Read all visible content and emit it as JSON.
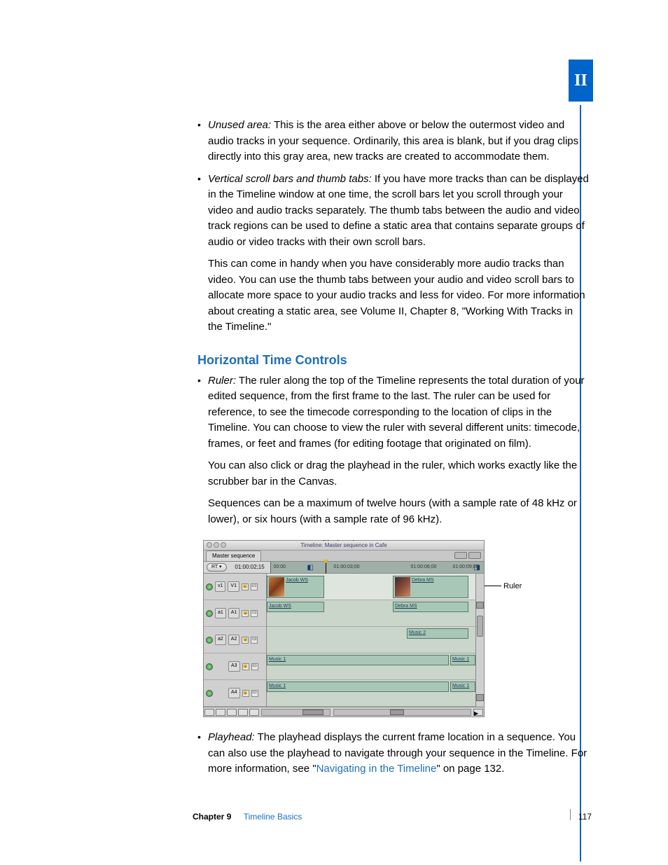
{
  "page": {
    "part_label": "II",
    "chapter_label": "Chapter 9",
    "chapter_title": "Timeline Basics",
    "page_number": "117"
  },
  "bullets_top": [
    {
      "term": "Unused area:",
      "text": "This is the area either above or below the outermost video and audio tracks in your sequence. Ordinarily, this area is blank, but if you drag clips directly into this gray area, new tracks are created to accommodate them."
    },
    {
      "term": "Vertical scroll bars and thumb tabs:",
      "text": "If you have more tracks than can be displayed in the Timeline window at one time, the scroll bars let you scroll through your video and audio tracks separately. The thumb tabs between the audio and video track regions can be used to define a static area that contains separate groups of audio or video tracks with their own scroll bars.",
      "extra": "This can come in handy when you have considerably more audio tracks than video. You can use the thumb tabs between your audio and video scroll bars to allocate more space to your audio tracks and less for video. For more information about creating a static area, see Volume II, Chapter 8, \"Working With Tracks in the Timeline.\""
    }
  ],
  "section_heading": "Horizontal Time Controls",
  "ruler_bullet": {
    "term": "Ruler:",
    "text": "The ruler along the top of the Timeline represents the total duration of your edited sequence, from the first frame to the last. The ruler can be used for reference, to see the timecode corresponding to the location of clips in the Timeline. You can choose to view the ruler with several different units: timecode, frames, or feet and frames (for editing footage that originated on film).",
    "p2": "You can also click or drag the playhead in the ruler, which works exactly like the scrubber bar in the Canvas.",
    "p3": "Sequences can be a maximum of twelve hours (with a sample rate of 48 kHz or lower), or six hours (with a sample rate of 96 kHz)."
  },
  "callouts": {
    "playhead": "Playhead",
    "ruler": "Ruler"
  },
  "timeline": {
    "window_title": "Timeline: Master sequence in Cafe",
    "tab": "Master sequence",
    "rt_label": "RT ▾",
    "timecode": "01:00:02;15",
    "ruler_ticks": [
      "00:00",
      "01:00:03;00",
      "01:00:06;00",
      "01:00:09;00"
    ],
    "tracks": [
      {
        "src": "v1",
        "dst": "V1",
        "type": "video"
      },
      {
        "src": "a1",
        "dst": "A1",
        "type": "audio"
      },
      {
        "src": "a2",
        "dst": "A2",
        "type": "audio"
      },
      {
        "src": "",
        "dst": "A3",
        "type": "audio"
      },
      {
        "src": "",
        "dst": "A4",
        "type": "audio"
      }
    ],
    "clips": {
      "jacob": "Jacob WS",
      "debra": "Debra MS",
      "music1": "Music 1",
      "music2": "Music 2"
    }
  },
  "playhead_bullet": {
    "term": "Playhead:",
    "text_pre": "The playhead displays the current frame location in a sequence. You can also use the playhead to navigate through your sequence in the Timeline. For more information, see \"",
    "link": "Navigating in the Timeline",
    "text_post": "\" on page 132."
  }
}
